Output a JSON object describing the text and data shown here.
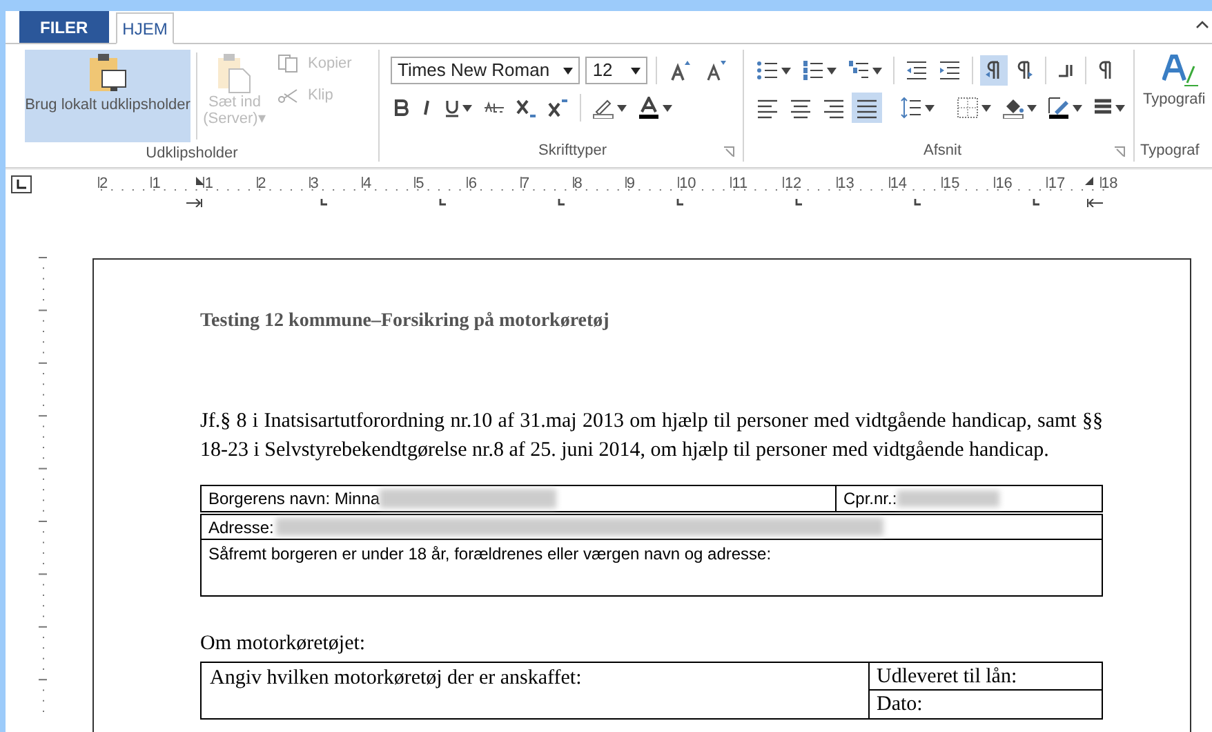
{
  "tabs": [
    {
      "label": "FILER",
      "kind": "file",
      "selected": false
    },
    {
      "label": "HJEM",
      "kind": "tab",
      "selected": true
    }
  ],
  "clipboard": {
    "label": "Udklipsholder",
    "local_button": {
      "label": "Brug lokalt udklipsholder",
      "selected": true
    },
    "paste_button": {
      "label": "Sæt ind (Server)▾",
      "disabled": true
    },
    "copy_button": {
      "label": "Kopier",
      "disabled": true
    },
    "cut_button": {
      "label": "Klip",
      "disabled": true
    }
  },
  "font": {
    "label": "Skrifttyper",
    "font_name": "Times New Roman",
    "font_size": "12"
  },
  "paragraph": {
    "label": "Afsnit",
    "direction_buttons": [
      {
        "selected": true
      },
      {
        "selected": false
      }
    ],
    "align_buttons": [
      {
        "selected": false
      },
      {
        "selected": false
      },
      {
        "selected": false
      },
      {
        "selected": true
      }
    ]
  },
  "typography": {
    "button_label": "Typografi",
    "label": "Typograf"
  },
  "ruler": {
    "numbers": [
      "2",
      "1",
      "1",
      "2",
      "3",
      "4",
      "5",
      "6",
      "7",
      "8",
      "9",
      "10",
      "11",
      "12",
      "13",
      "14",
      "15",
      "16",
      "17",
      "18"
    ]
  },
  "document": {
    "title": "Testing 12 kommune–Forsikring på motorkøretøj",
    "paragraph": "Jf.§ 8 i Inatsisartutforordning nr.10 af 31.maj 2013 om hjælp til personer med vidtgående handicap, samt §§ 18-23 i Selvstyrebekendtgørelse nr.8 af 25. juni 2014, om hjælp til personer med vidtgående handicap.",
    "citizen_table": {
      "name_label": "Borgerens navn: Minna",
      "cpr_label": "Cpr.nr.:",
      "address_label": "Adresse:",
      "guardian_label": "Såfremt borgeren er under 18 år, forældrenes eller værgen navn og adresse:"
    },
    "vehicle_heading": "Om motorkøretøjet:",
    "vehicle_table": {
      "vehicle_label": "Angiv hvilken motorkøretøj der er anskaffet:",
      "loan_label": "Udleveret til lån:",
      "date_label": "Dato:"
    }
  }
}
